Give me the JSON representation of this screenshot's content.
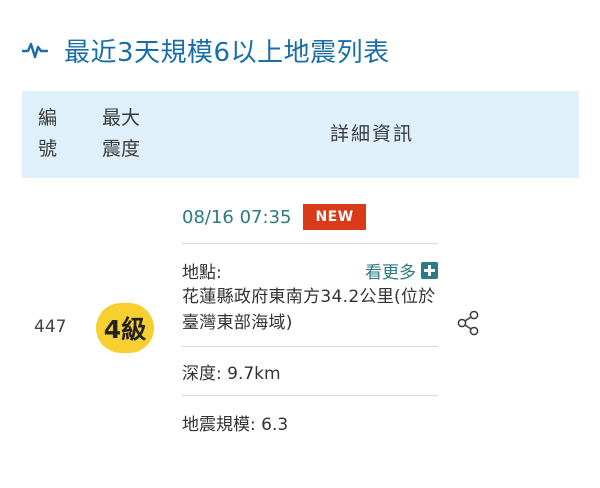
{
  "header": {
    "title": "最近3天規模6以上地震列表",
    "icon": "pulse-icon"
  },
  "table": {
    "columns": {
      "id": [
        "編",
        "號"
      ],
      "intensity": [
        "最大",
        "震度"
      ],
      "detail": "詳細資訊"
    },
    "rows": [
      {
        "id": "447",
        "intensity": "4級",
        "time": "08/16 07:35",
        "new_badge": "NEW",
        "location_label": "地點:",
        "more_label": "看更多",
        "location": "花蓮縣政府東南方34.2公里(位於臺灣東部海域)",
        "depth": "深度: 9.7km",
        "magnitude": "地震規模: 6.3"
      }
    ]
  },
  "colors": {
    "accent": "#1a6ea8",
    "header_bg": "#dff0fb",
    "intensity_bg": "#f7cf2f",
    "new_badge_bg": "#d83a1a",
    "link": "#2b7a84"
  }
}
